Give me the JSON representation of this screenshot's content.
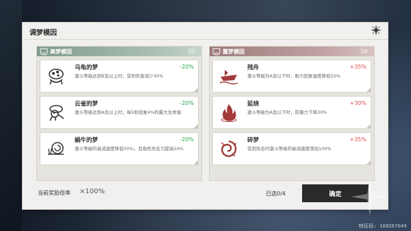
{
  "dialog": {
    "title": "调梦模因"
  },
  "panels": {
    "good": {
      "title": "美梦模因",
      "items": [
        {
          "name": "乌龟的梦",
          "pct": "-20%",
          "desc": "激斗等级达到B及以上时，受到伤害减少30%",
          "icon": "turtle-icon"
        },
        {
          "name": "云雀的梦",
          "pct": "-20%",
          "desc": "激斗等级达到A及以上时，每5秒回复4%的最大生命值",
          "icon": "lark-icon"
        },
        {
          "name": "蜗牛的梦",
          "pct": "-20%",
          "desc": "激斗等级的衰减速度降低50%，且角色攻击力提高50%",
          "icon": "snail-icon"
        }
      ]
    },
    "bad": {
      "title": "噩梦模因",
      "items": [
        {
          "name": "残舟",
          "pct": "+35%",
          "desc": "激斗等级为A及以下时，耐力回复速度降低50%",
          "icon": "wrecked-boat-icon"
        },
        {
          "name": "延烧",
          "pct": "+30%",
          "desc": "激斗等级为A及以下时，防御力下降30%",
          "icon": "flame-icon"
        },
        {
          "name": "碎梦",
          "pct": "+35%",
          "desc": "受到攻击时激斗等级的衰减速度增加100%",
          "icon": "shattered-swirl-icon"
        }
      ]
    }
  },
  "footer": {
    "reward_label": "当前奖励倍率",
    "reward_value": "×100%",
    "selected": "已选0/4",
    "confirm_label": "确定"
  },
  "watermark": "特征码: 108267049",
  "colors": {
    "good_header": "#7e9a8a",
    "bad_header": "#9c7a7a",
    "good_pct": "#2aa34a",
    "bad_pct": "#e04848",
    "confirm_bg": "#2a2a2a"
  }
}
